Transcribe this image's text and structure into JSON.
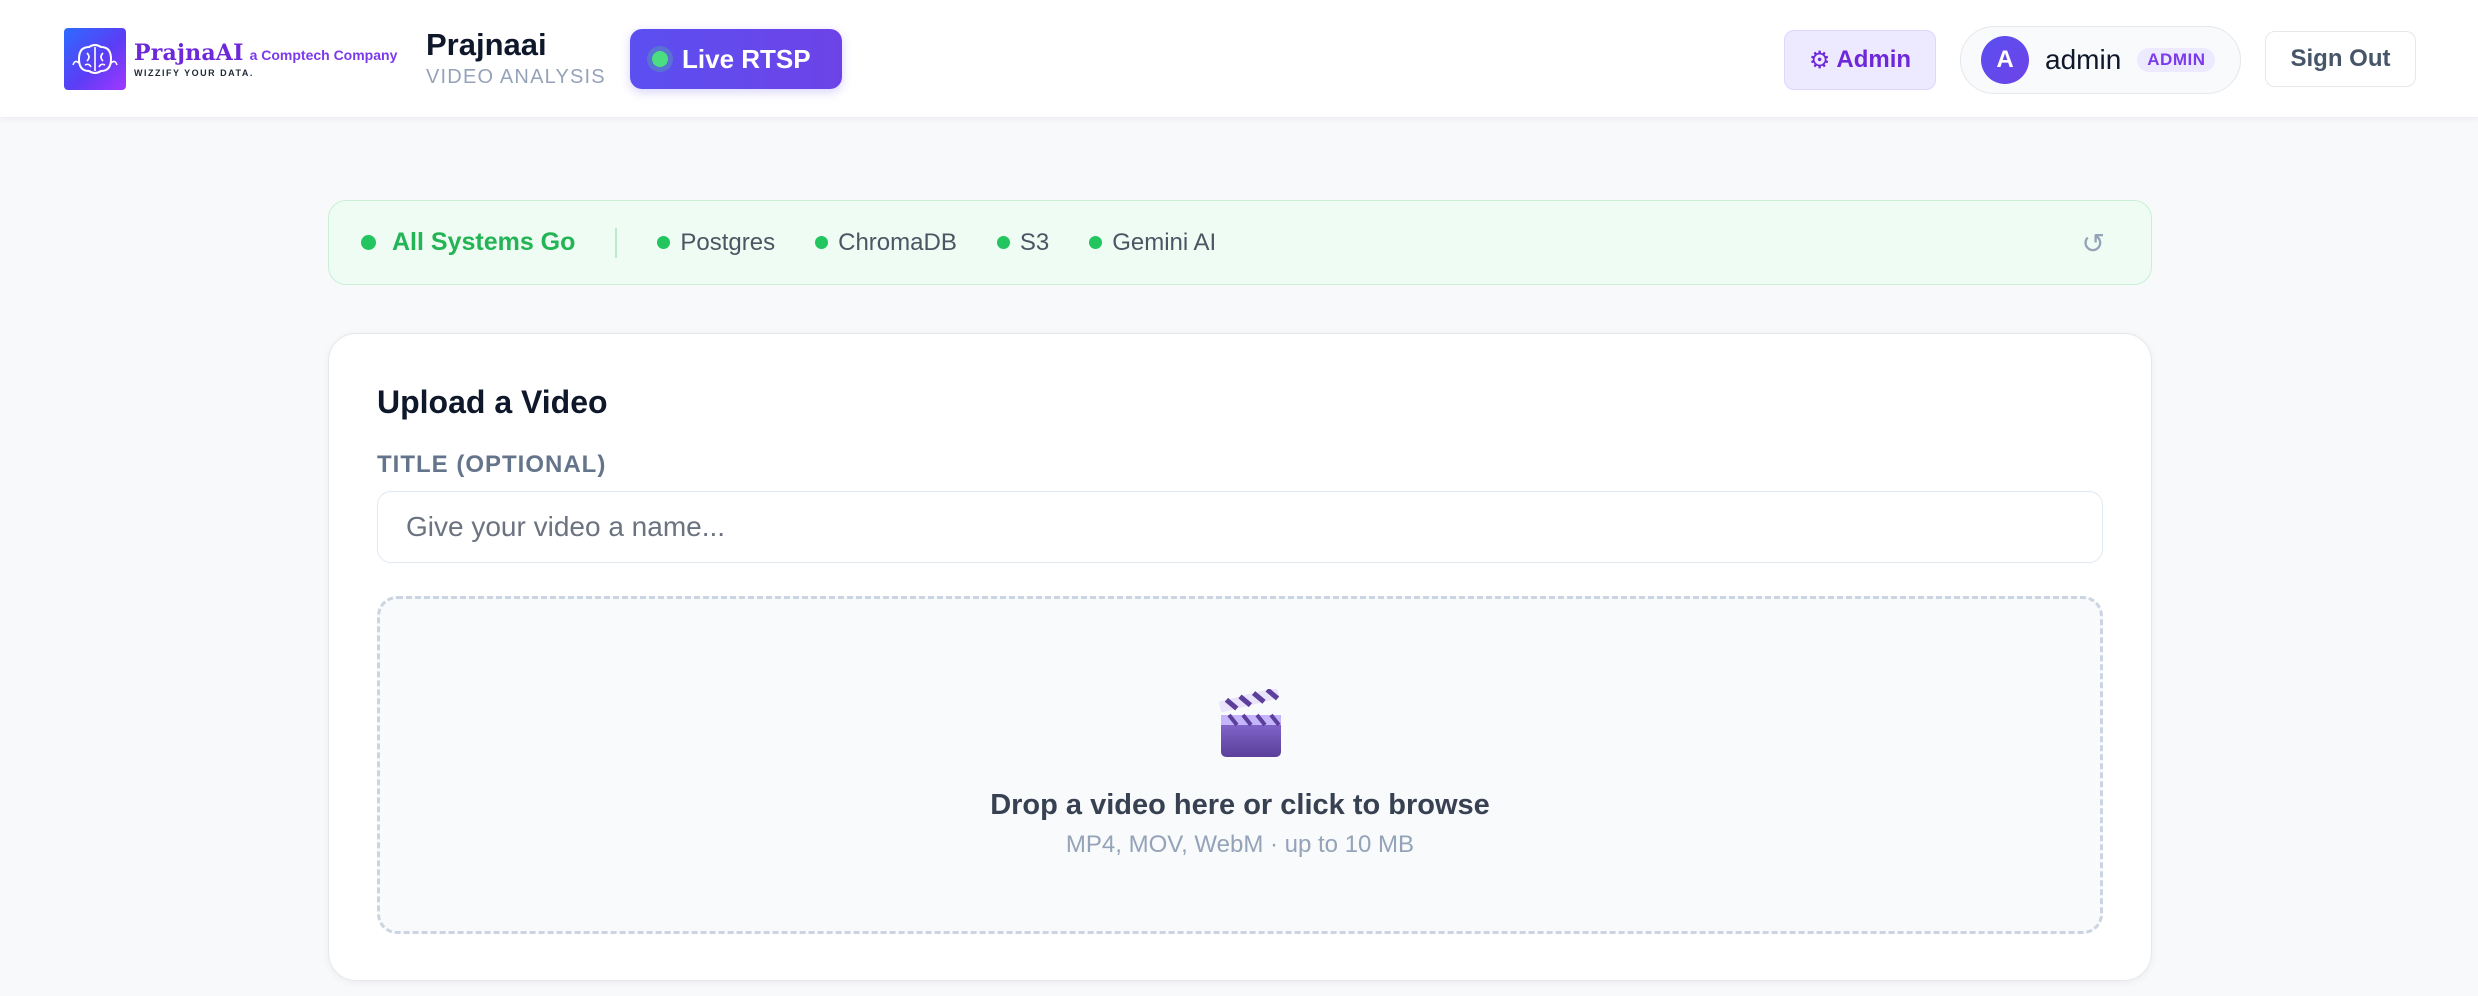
{
  "header": {
    "logo": {
      "name": "PrajnaAI",
      "company": "a Comptech Company",
      "tagline": "WIZZIFY YOUR DATA."
    },
    "brand_title": "Prajnaai",
    "brand_subtitle": "VIDEO ANALYSIS",
    "live_button": {
      "label": "Live RTSP",
      "icon": "live-dot",
      "dot_color": "#4ade80"
    },
    "admin_button": {
      "label": "Admin",
      "icon": "gear-icon"
    },
    "user": {
      "avatar_initial": "A",
      "name": "admin",
      "role": "ADMIN"
    },
    "sign_out_label": "Sign Out"
  },
  "status": {
    "headline": "All Systems Go",
    "headline_color": "#22b455",
    "services": [
      {
        "name": "Postgres",
        "status": "ok"
      },
      {
        "name": "ChromaDB",
        "status": "ok"
      },
      {
        "name": "S3",
        "status": "ok"
      },
      {
        "name": "Gemini AI",
        "status": "ok"
      }
    ],
    "refresh_icon": "refresh-icon"
  },
  "upload": {
    "title": "Upload a Video",
    "field_label": "TITLE (OPTIONAL)",
    "title_placeholder": "Give your video a name...",
    "title_value": "",
    "dropzone": {
      "icon": "clapperboard-icon",
      "title": "Drop a video here or click to browse",
      "subtitle": "MP4, MOV, WebM · up to 10 MB"
    }
  },
  "colors": {
    "accent": "#5b4ff0",
    "status_ok": "#22c55e",
    "admin_purple": "#6d28d9"
  }
}
